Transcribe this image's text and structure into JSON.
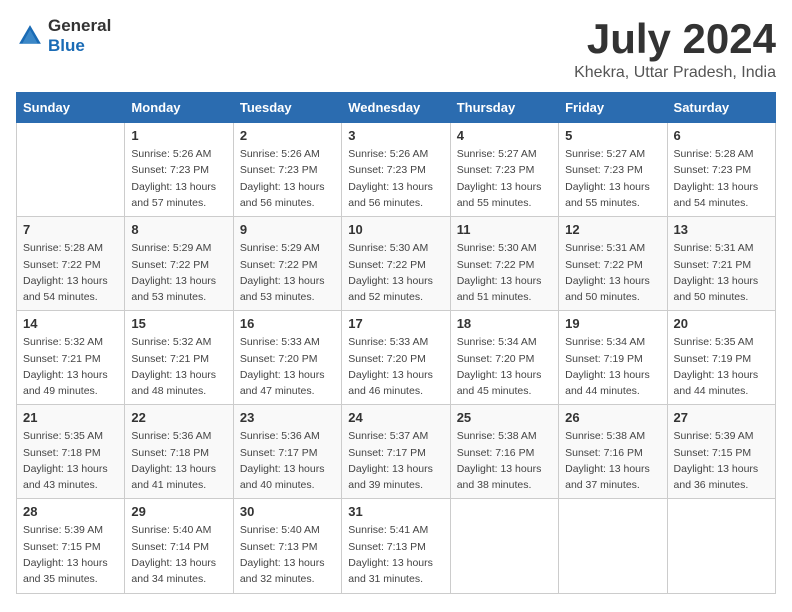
{
  "logo": {
    "general": "General",
    "blue": "Blue"
  },
  "title": "July 2024",
  "subtitle": "Khekra, Uttar Pradesh, India",
  "weekdays": [
    "Sunday",
    "Monday",
    "Tuesday",
    "Wednesday",
    "Thursday",
    "Friday",
    "Saturday"
  ],
  "weeks": [
    [
      {
        "day": "",
        "detail": ""
      },
      {
        "day": "1",
        "detail": "Sunrise: 5:26 AM\nSunset: 7:23 PM\nDaylight: 13 hours\nand 57 minutes."
      },
      {
        "day": "2",
        "detail": "Sunrise: 5:26 AM\nSunset: 7:23 PM\nDaylight: 13 hours\nand 56 minutes."
      },
      {
        "day": "3",
        "detail": "Sunrise: 5:26 AM\nSunset: 7:23 PM\nDaylight: 13 hours\nand 56 minutes."
      },
      {
        "day": "4",
        "detail": "Sunrise: 5:27 AM\nSunset: 7:23 PM\nDaylight: 13 hours\nand 55 minutes."
      },
      {
        "day": "5",
        "detail": "Sunrise: 5:27 AM\nSunset: 7:23 PM\nDaylight: 13 hours\nand 55 minutes."
      },
      {
        "day": "6",
        "detail": "Sunrise: 5:28 AM\nSunset: 7:23 PM\nDaylight: 13 hours\nand 54 minutes."
      }
    ],
    [
      {
        "day": "7",
        "detail": "Sunrise: 5:28 AM\nSunset: 7:22 PM\nDaylight: 13 hours\nand 54 minutes."
      },
      {
        "day": "8",
        "detail": "Sunrise: 5:29 AM\nSunset: 7:22 PM\nDaylight: 13 hours\nand 53 minutes."
      },
      {
        "day": "9",
        "detail": "Sunrise: 5:29 AM\nSunset: 7:22 PM\nDaylight: 13 hours\nand 53 minutes."
      },
      {
        "day": "10",
        "detail": "Sunrise: 5:30 AM\nSunset: 7:22 PM\nDaylight: 13 hours\nand 52 minutes."
      },
      {
        "day": "11",
        "detail": "Sunrise: 5:30 AM\nSunset: 7:22 PM\nDaylight: 13 hours\nand 51 minutes."
      },
      {
        "day": "12",
        "detail": "Sunrise: 5:31 AM\nSunset: 7:22 PM\nDaylight: 13 hours\nand 50 minutes."
      },
      {
        "day": "13",
        "detail": "Sunrise: 5:31 AM\nSunset: 7:21 PM\nDaylight: 13 hours\nand 50 minutes."
      }
    ],
    [
      {
        "day": "14",
        "detail": "Sunrise: 5:32 AM\nSunset: 7:21 PM\nDaylight: 13 hours\nand 49 minutes."
      },
      {
        "day": "15",
        "detail": "Sunrise: 5:32 AM\nSunset: 7:21 PM\nDaylight: 13 hours\nand 48 minutes."
      },
      {
        "day": "16",
        "detail": "Sunrise: 5:33 AM\nSunset: 7:20 PM\nDaylight: 13 hours\nand 47 minutes."
      },
      {
        "day": "17",
        "detail": "Sunrise: 5:33 AM\nSunset: 7:20 PM\nDaylight: 13 hours\nand 46 minutes."
      },
      {
        "day": "18",
        "detail": "Sunrise: 5:34 AM\nSunset: 7:20 PM\nDaylight: 13 hours\nand 45 minutes."
      },
      {
        "day": "19",
        "detail": "Sunrise: 5:34 AM\nSunset: 7:19 PM\nDaylight: 13 hours\nand 44 minutes."
      },
      {
        "day": "20",
        "detail": "Sunrise: 5:35 AM\nSunset: 7:19 PM\nDaylight: 13 hours\nand 44 minutes."
      }
    ],
    [
      {
        "day": "21",
        "detail": "Sunrise: 5:35 AM\nSunset: 7:18 PM\nDaylight: 13 hours\nand 43 minutes."
      },
      {
        "day": "22",
        "detail": "Sunrise: 5:36 AM\nSunset: 7:18 PM\nDaylight: 13 hours\nand 41 minutes."
      },
      {
        "day": "23",
        "detail": "Sunrise: 5:36 AM\nSunset: 7:17 PM\nDaylight: 13 hours\nand 40 minutes."
      },
      {
        "day": "24",
        "detail": "Sunrise: 5:37 AM\nSunset: 7:17 PM\nDaylight: 13 hours\nand 39 minutes."
      },
      {
        "day": "25",
        "detail": "Sunrise: 5:38 AM\nSunset: 7:16 PM\nDaylight: 13 hours\nand 38 minutes."
      },
      {
        "day": "26",
        "detail": "Sunrise: 5:38 AM\nSunset: 7:16 PM\nDaylight: 13 hours\nand 37 minutes."
      },
      {
        "day": "27",
        "detail": "Sunrise: 5:39 AM\nSunset: 7:15 PM\nDaylight: 13 hours\nand 36 minutes."
      }
    ],
    [
      {
        "day": "28",
        "detail": "Sunrise: 5:39 AM\nSunset: 7:15 PM\nDaylight: 13 hours\nand 35 minutes."
      },
      {
        "day": "29",
        "detail": "Sunrise: 5:40 AM\nSunset: 7:14 PM\nDaylight: 13 hours\nand 34 minutes."
      },
      {
        "day": "30",
        "detail": "Sunrise: 5:40 AM\nSunset: 7:13 PM\nDaylight: 13 hours\nand 32 minutes."
      },
      {
        "day": "31",
        "detail": "Sunrise: 5:41 AM\nSunset: 7:13 PM\nDaylight: 13 hours\nand 31 minutes."
      },
      {
        "day": "",
        "detail": ""
      },
      {
        "day": "",
        "detail": ""
      },
      {
        "day": "",
        "detail": ""
      }
    ]
  ]
}
